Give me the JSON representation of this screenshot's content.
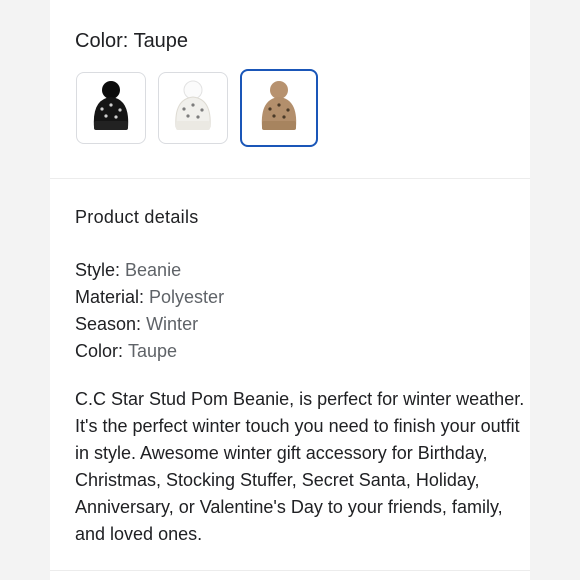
{
  "variant": {
    "label": "Color:",
    "selected": "Taupe",
    "swatches": [
      {
        "color": "Black",
        "hex": "#151515",
        "pom": "#0c0c0c"
      },
      {
        "color": "White",
        "hex": "#f4f3ef",
        "pom": "#fafafa"
      },
      {
        "color": "Taupe",
        "hex": "#b38f6c",
        "pom": "#b7926f"
      }
    ],
    "selected_index": 2
  },
  "details": {
    "title": "Product details",
    "specs": [
      {
        "key": "Style:",
        "value": "Beanie"
      },
      {
        "key": "Material:",
        "value": "Polyester"
      },
      {
        "key": "Season:",
        "value": "Winter"
      },
      {
        "key": "Color:",
        "value": "Taupe"
      }
    ],
    "description": "C.C Star Stud Pom Beanie, is perfect for winter weather. It's the perfect winter touch you need to finish your outfit in style. Awesome winter gift accessory for Birthday, Christmas, Stocking Stuffer, Secret Santa, Holiday, Anniversary, or Valentine's Day to your friends, family, and loved ones."
  },
  "colors": {
    "selected_border": "#1a56b8",
    "text_primary": "#202124",
    "text_secondary": "#5f6368"
  }
}
